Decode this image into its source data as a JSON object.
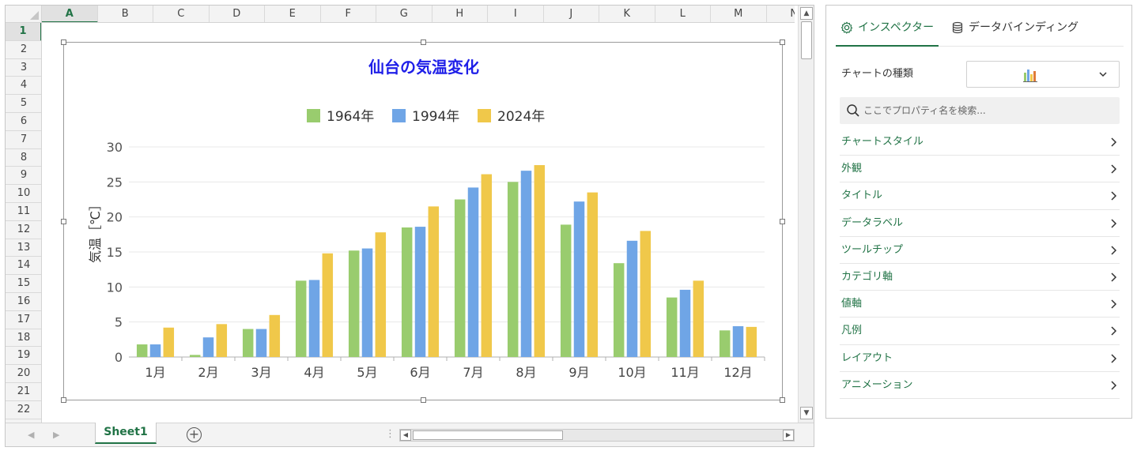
{
  "spreadsheet": {
    "columns": [
      "A",
      "B",
      "C",
      "D",
      "E",
      "F",
      "G",
      "H",
      "I",
      "J",
      "K",
      "L",
      "M",
      "N"
    ],
    "selected_column": "A",
    "rows": [
      "1",
      "2",
      "3",
      "4",
      "5",
      "6",
      "7",
      "8",
      "9",
      "10",
      "11",
      "12",
      "13",
      "14",
      "15",
      "16",
      "17",
      "18",
      "19",
      "20",
      "21",
      "22"
    ],
    "selected_row": "1",
    "sheet_tab": "Sheet1"
  },
  "chart_data": {
    "type": "bar",
    "title": "仙台の気温変化",
    "title_color": "#1f1fe8",
    "ylabel": "気温［℃］",
    "xlabel": "",
    "ylim": [
      0,
      30
    ],
    "yticks": [
      0,
      5,
      10,
      15,
      20,
      25,
      30
    ],
    "grid": true,
    "legend_position": "top",
    "categories": [
      "1月",
      "2月",
      "3月",
      "4月",
      "5月",
      "6月",
      "7月",
      "8月",
      "9月",
      "10月",
      "11月",
      "12月"
    ],
    "series": [
      {
        "name": "1964年",
        "color": "#99cc6e",
        "values": [
          1.8,
          0.3,
          4.0,
          10.9,
          15.2,
          18.5,
          22.5,
          25.0,
          18.9,
          13.4,
          8.5,
          3.8
        ]
      },
      {
        "name": "1994年",
        "color": "#6fa5e6",
        "values": [
          1.8,
          2.8,
          4.0,
          11.0,
          15.5,
          18.6,
          24.2,
          26.6,
          22.2,
          16.6,
          9.6,
          4.4
        ]
      },
      {
        "name": "2024年",
        "color": "#f0c84a",
        "values": [
          4.2,
          4.7,
          6.0,
          14.8,
          17.8,
          21.5,
          26.1,
          27.4,
          23.5,
          18.0,
          10.9,
          4.3
        ]
      }
    ]
  },
  "inspector": {
    "tabs": [
      {
        "label": "インスペクター",
        "icon": "gear-icon",
        "active": true
      },
      {
        "label": "データバインディング",
        "icon": "database-icon",
        "active": false
      }
    ],
    "chart_type_label": "チャートの種類",
    "chart_type_icon": "bar-chart-icon",
    "search_placeholder": "ここでプロパティ名を検索...",
    "properties": [
      "チャートスタイル",
      "外観",
      "タイトル",
      "データラベル",
      "ツールチップ",
      "カテゴリ軸",
      "値軸",
      "凡例",
      "レイアウト",
      "アニメーション"
    ],
    "accent_color": "#217346"
  }
}
